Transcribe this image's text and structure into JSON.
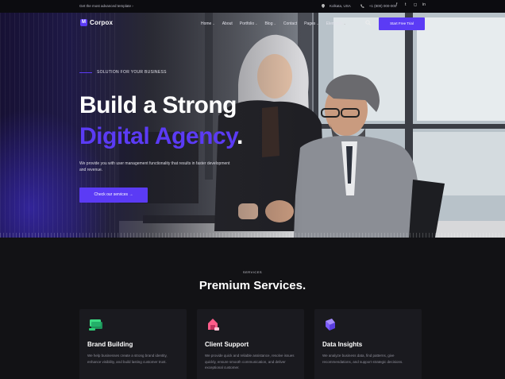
{
  "topbar": {
    "promo": "Get the most advanced template ›",
    "location": "Kolkata, USA",
    "phone": "+1 (800) 000-000",
    "social_icons": [
      "facebook-icon",
      "twitter-icon",
      "instagram-icon",
      "linkedin-icon"
    ]
  },
  "nav": {
    "logo_text": "Corpox",
    "logo_mark": "M",
    "items": [
      "Home",
      "About",
      "Portfolio",
      "Blog",
      "Contact",
      "Pages",
      "Elements"
    ],
    "cta": "Start Free Trial"
  },
  "hero": {
    "eyebrow": "SOLUTION FOR YOUR BUSINESS",
    "title_line1": "Build a Strong",
    "title_line2": "Digital Agency",
    "title_dot": ".",
    "description": "We provide you with user management functionality that results in faster development and revenue.",
    "button": "Check our services →"
  },
  "services": {
    "eyebrow": "SERVICES",
    "title": "Premium Services.",
    "cards": [
      {
        "title": "Brand Building",
        "text": "We help businesses create a strong brand identity, enhance visibility, and build lasting customer trust.",
        "icon": "brand-building-icon",
        "accent": "#3ddc84"
      },
      {
        "title": "Client Support",
        "text": "We provide quick and reliable assistance, resolve issues quickly, ensure smooth communication, and deliver exceptional customer.",
        "icon": "client-support-icon",
        "accent": "#ff5c8a"
      },
      {
        "title": "Data Insights",
        "text": "We analyze business data, find patterns, give recommendations, and support strategic decisions.",
        "icon": "data-insights-icon",
        "accent": "#7b5cff"
      }
    ]
  },
  "colors": {
    "accent": "#5b3bf5",
    "background": "#121215"
  }
}
